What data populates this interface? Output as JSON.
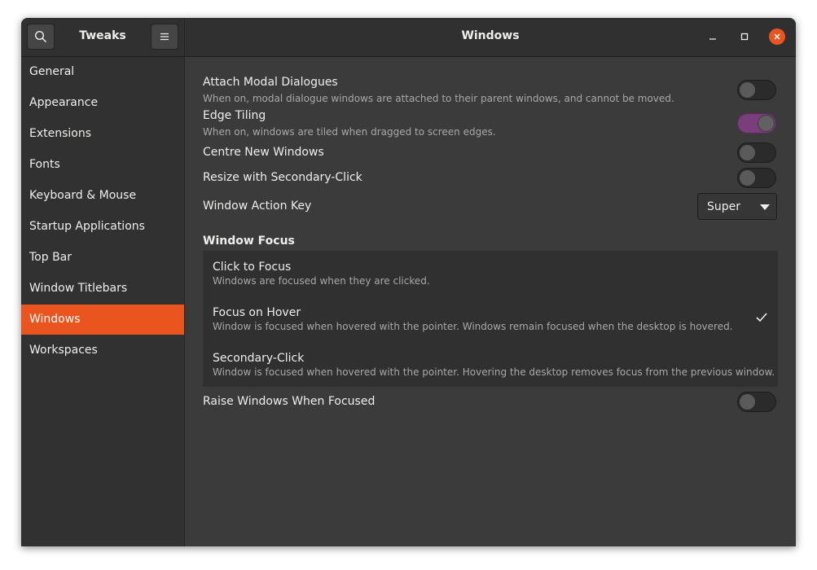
{
  "app": {
    "title": "Tweaks"
  },
  "header": {
    "section_title": "Windows",
    "search_icon": "search-icon",
    "menu_icon": "menu-icon"
  },
  "colors": {
    "accent": "#e9541f",
    "toggle_on": "#7a3e7c"
  },
  "sidebar": {
    "items": [
      {
        "label": "General"
      },
      {
        "label": "Appearance"
      },
      {
        "label": "Extensions"
      },
      {
        "label": "Fonts"
      },
      {
        "label": "Keyboard & Mouse"
      },
      {
        "label": "Startup Applications"
      },
      {
        "label": "Top Bar"
      },
      {
        "label": "Window Titlebars"
      },
      {
        "label": "Windows",
        "active": true
      },
      {
        "label": "Workspaces"
      }
    ]
  },
  "settings": {
    "attach_modal": {
      "title": "Attach Modal Dialogues",
      "subtitle": "When on, modal dialogue windows are attached to their parent windows, and cannot be moved.",
      "enabled": false
    },
    "edge_tiling": {
      "title": "Edge Tiling",
      "subtitle": "When on, windows are tiled when dragged to screen edges.",
      "enabled": true
    },
    "centre_new": {
      "title": "Centre New Windows",
      "enabled": false
    },
    "resize_secondary": {
      "title": "Resize with Secondary-Click",
      "enabled": false
    },
    "action_key": {
      "title": "Window Action Key",
      "value": "Super"
    },
    "window_focus": {
      "title": "Window Focus",
      "options": [
        {
          "title": "Click to Focus",
          "subtitle": "Windows are focused when they are clicked.",
          "selected": false
        },
        {
          "title": "Focus on Hover",
          "subtitle": "Window is focused when hovered with the pointer. Windows remain focused when the desktop is hovered.",
          "selected": true
        },
        {
          "title": "Secondary-Click",
          "subtitle": "Window is focused when hovered with the pointer. Hovering the desktop removes focus from the previous window.",
          "selected": false
        }
      ]
    },
    "raise_focused": {
      "title": "Raise Windows When Focused",
      "enabled": false
    }
  }
}
